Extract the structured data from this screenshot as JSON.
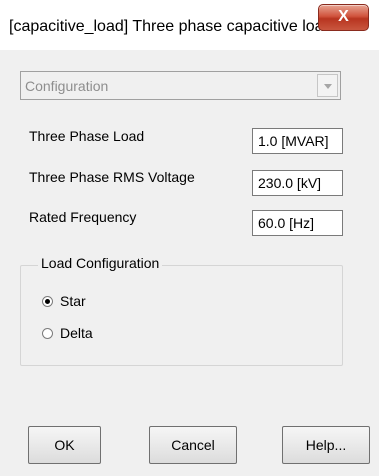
{
  "window": {
    "title": "[capacitive_load] Three phase capacitive load"
  },
  "close_button": {
    "label": "X"
  },
  "category": {
    "selected": "Configuration"
  },
  "parameters": [
    {
      "label": "Three Phase Load",
      "value": "1.0 [MVAR]"
    },
    {
      "label": "Three Phase RMS Voltage",
      "value": "230.0 [kV]"
    },
    {
      "label": "Rated Frequency",
      "value": "60.0 [Hz]"
    }
  ],
  "load_configuration": {
    "title": "Load Configuration",
    "options": [
      {
        "label": "Star",
        "selected": true
      },
      {
        "label": "Delta",
        "selected": false
      }
    ]
  },
  "buttons": {
    "ok": "OK",
    "cancel": "Cancel",
    "help": "Help..."
  }
}
